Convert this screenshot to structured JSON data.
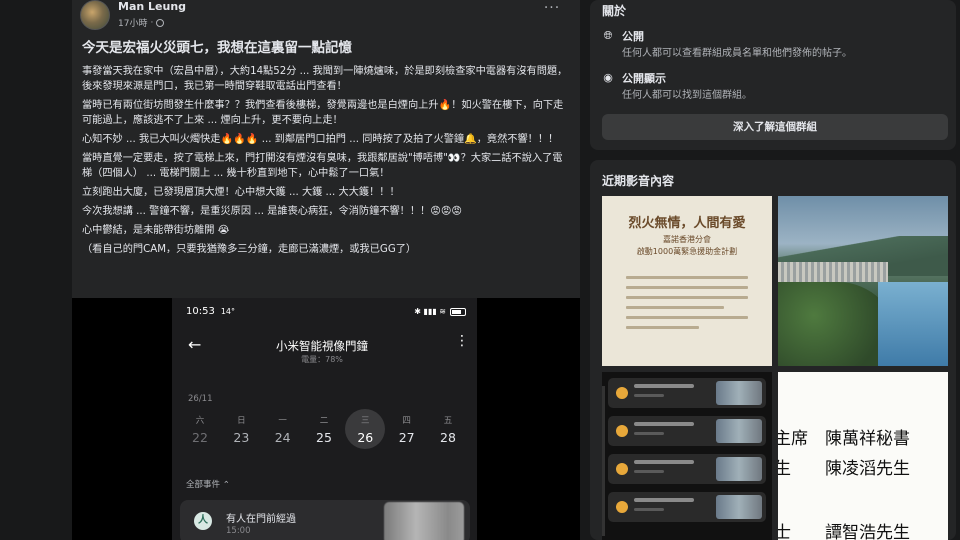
{
  "post": {
    "author": "Man Leung",
    "time": "17小時",
    "more": "···",
    "title": "今天是宏福火災頭七，我想在這裏留一點記憶",
    "paragraphs": [
      "事發當天我在家中（宏昌中層），大約14點52分 ... 我聞到一陣燒爐味，於是即刻檢查家中電器有沒有問題，後來發現來源是門口，我已第一時間穿鞋取電話出門查看！",
      "當時已有兩位街坊問發生什麼事？？我們查看後樓梯，發覺兩邊也是白煙向上升🔥！如火警在樓下，向下走可能過上，應該逃不了上來 ... 煙向上升，更不要向上走！",
      "心知不妙 ... 我已大叫火燭快走🔥🔥🔥 ... 到鄰居門口拍門 ... 同時按了及拍了火警鐘🔔，竟然不響！！！",
      "當時直覺一定要走，按了電梯上來，門打開沒有煙沒有臭味，我跟鄰居說\"博唔博\"👀？大家二話不說入了電梯（四個人） ... 電梯門關上 ... 幾十秒直到地下，心中鬆了一口氣！",
      "立刻跑出大廈，已發現層頂大煙！心中想大鑊 ... 大鑊 ... 大大鑊！！！",
      "今次我想講 ... 警鐘不響，是重災原因 ... 是誰喪心病狂，令消防鐘不響！！！😡😡😡",
      "心中鬱結，是未能帶街坊離開 😭",
      "（看自己的門CAM，只要我猶豫多三分鐘，走廊已滿濃煙，或我已GG了）"
    ]
  },
  "phone": {
    "clock": "10:53",
    "temp": "14°",
    "status_icons": "✱ ▮▮▮ ≋ ",
    "battery": "",
    "title": "小米智能視像門鐘",
    "battery_label": "電量：78%",
    "month": "26/11",
    "days": [
      {
        "dow": "六",
        "num": "22"
      },
      {
        "dow": "日",
        "num": "23"
      },
      {
        "dow": "一",
        "num": "24"
      },
      {
        "dow": "二",
        "num": "25"
      },
      {
        "dow": "三",
        "num": "26"
      },
      {
        "dow": "四",
        "num": "27"
      },
      {
        "dow": "五",
        "num": "28"
      }
    ],
    "filter": "全部事件 ⌃",
    "event": {
      "title": "有人在門前經過",
      "time": "15:00",
      "icon": "人"
    }
  },
  "about": {
    "title": "關於",
    "public_label": "公開",
    "public_desc": "任何人都可以查看群組成員名單和他們發佈的帖子。",
    "visible_label": "公開顯示",
    "visible_desc": "任何人都可以找到這個群組。",
    "learn_more": "深入了解這個群組"
  },
  "recent_media": {
    "title": "近期影音內容",
    "poster_head": "烈火無情，人間有愛",
    "poster_sub": "嘉諾香港分會\n啟動1000萬緊急援助金計劃",
    "names_lines": [
      "主席　陳萬祥秘書",
      "生　　陳凌滔先生",
      "士　　譚智浩先生"
    ]
  },
  "icons": {
    "globe": "globe-icon",
    "eye": "eye-icon",
    "back": "back-arrow-icon",
    "more": "more-dots-icon"
  },
  "colors": {
    "background": "#18191a",
    "card": "#242526",
    "button": "#3a3b3c",
    "text": "#e4e6eb",
    "secondary": "#b0b3b8"
  }
}
